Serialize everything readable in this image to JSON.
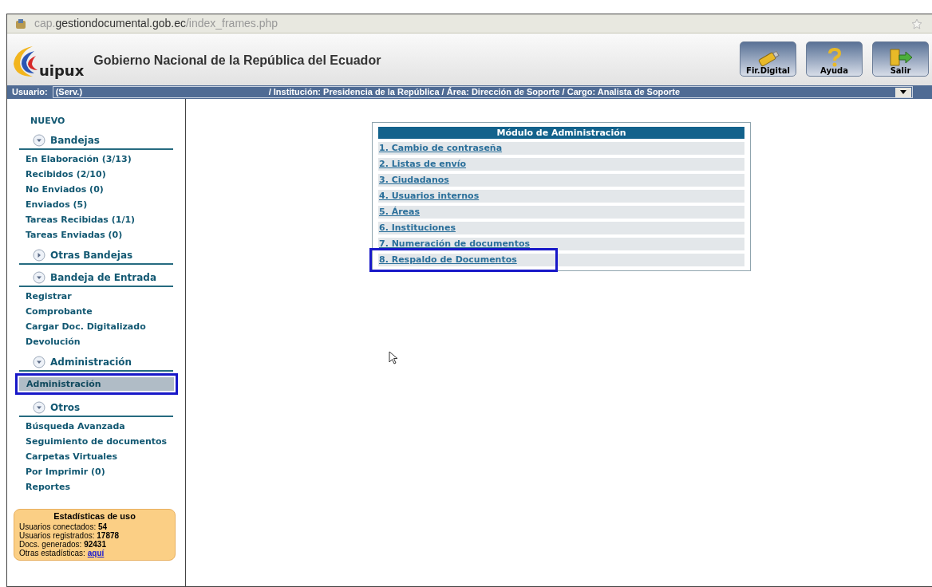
{
  "address_bar": {
    "url_host_prefix": "cap.",
    "url_host": "gestiondocumental.gob.ec",
    "url_path": "/index_frames.php"
  },
  "header": {
    "logo_text": "uipux",
    "title": "Gobierno Nacional de la República del Ecuador",
    "buttons": [
      {
        "kind": "usb",
        "label": "Fir.Digital"
      },
      {
        "kind": "help",
        "label": "Ayuda"
      },
      {
        "kind": "exit",
        "label": "Salir"
      }
    ]
  },
  "user_bar": {
    "label": "Usuario:",
    "user": "(Serv.)",
    "role": "/ Institución: Presidencia de la República / Área: Dirección de Soporte / Cargo: Analista de Soporte"
  },
  "sidebar": {
    "new_link": "NUEVO",
    "sections": [
      {
        "title": "Bandejas",
        "expanded": true,
        "items": [
          {
            "label": "En Elaboración (3/13)",
            "selected": false
          },
          {
            "label": "Recibidos (2/10)",
            "selected": false
          },
          {
            "label": "No Enviados (0)",
            "selected": false
          },
          {
            "label": "Enviados (5)",
            "selected": false
          },
          {
            "label": "Tareas Recibidas (1/1)",
            "selected": false
          },
          {
            "label": "Tareas Enviadas (0)",
            "selected": false
          }
        ]
      },
      {
        "title": "Otras Bandejas",
        "expanded": false
      },
      {
        "title": "Bandeja de Entrada",
        "expanded": true,
        "items": [
          {
            "label": "Registrar",
            "selected": false
          },
          {
            "label": "Comprobante",
            "selected": false
          },
          {
            "label": "Cargar Doc. Digitalizado",
            "selected": false
          },
          {
            "label": "Devolución",
            "selected": false
          }
        ]
      },
      {
        "title": "Administración",
        "expanded": true,
        "items": [
          {
            "label": "Administración",
            "selected": true
          }
        ]
      },
      {
        "title": "Otros",
        "expanded": true,
        "items": [
          {
            "label": "Búsqueda Avanzada",
            "selected": false
          },
          {
            "label": "Seguimiento de documentos",
            "selected": false
          },
          {
            "label": "Carpetas Virtuales",
            "selected": false
          },
          {
            "label": "Por Imprimir (0)",
            "selected": false
          },
          {
            "label": "Reportes",
            "selected": false
          }
        ]
      }
    ],
    "stats": {
      "title": "Estadísticas de uso",
      "lines": [
        "Usuarios conectados: **54**",
        "Usuarios registrados: **17878**",
        "Docs. generados: **92431**"
      ],
      "link_prefix": "Otras estadísticas:",
      "link": "aquí"
    }
  },
  "module": {
    "title": "Módulo de Administración",
    "links": [
      {
        "label": "1. Cambio de contraseña",
        "highlighted": false
      },
      {
        "label": "2. Listas de envío",
        "highlighted": false
      },
      {
        "label": "3. Ciudadanos",
        "highlighted": false
      },
      {
        "label": "4. Usuarios internos",
        "highlighted": false
      },
      {
        "label": "5. Áreas",
        "highlighted": false
      },
      {
        "label": "6. Instituciones",
        "highlighted": false
      },
      {
        "label": "7. Numeración de documentos",
        "highlighted": false
      },
      {
        "label": "8. Respaldo de Documentos",
        "highlighted": true
      }
    ]
  }
}
